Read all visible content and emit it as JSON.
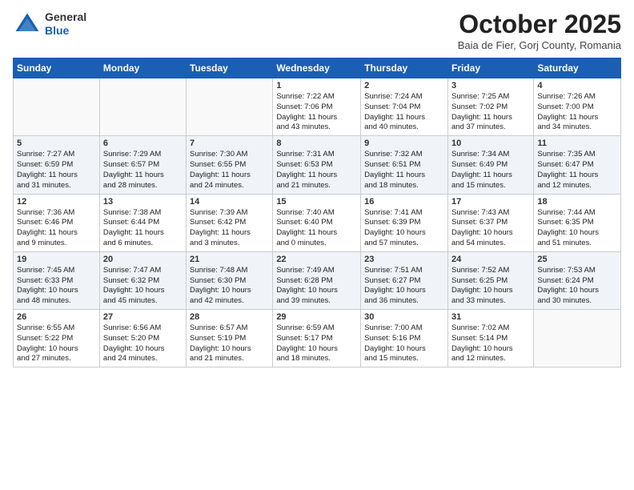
{
  "header": {
    "logo_general": "General",
    "logo_blue": "Blue",
    "month": "October 2025",
    "location": "Baia de Fier, Gorj County, Romania"
  },
  "weekdays": [
    "Sunday",
    "Monday",
    "Tuesday",
    "Wednesday",
    "Thursday",
    "Friday",
    "Saturday"
  ],
  "weeks": [
    [
      {
        "day": "",
        "info": ""
      },
      {
        "day": "",
        "info": ""
      },
      {
        "day": "",
        "info": ""
      },
      {
        "day": "1",
        "info": "Sunrise: 7:22 AM\nSunset: 7:06 PM\nDaylight: 11 hours\nand 43 minutes."
      },
      {
        "day": "2",
        "info": "Sunrise: 7:24 AM\nSunset: 7:04 PM\nDaylight: 11 hours\nand 40 minutes."
      },
      {
        "day": "3",
        "info": "Sunrise: 7:25 AM\nSunset: 7:02 PM\nDaylight: 11 hours\nand 37 minutes."
      },
      {
        "day": "4",
        "info": "Sunrise: 7:26 AM\nSunset: 7:00 PM\nDaylight: 11 hours\nand 34 minutes."
      }
    ],
    [
      {
        "day": "5",
        "info": "Sunrise: 7:27 AM\nSunset: 6:59 PM\nDaylight: 11 hours\nand 31 minutes."
      },
      {
        "day": "6",
        "info": "Sunrise: 7:29 AM\nSunset: 6:57 PM\nDaylight: 11 hours\nand 28 minutes."
      },
      {
        "day": "7",
        "info": "Sunrise: 7:30 AM\nSunset: 6:55 PM\nDaylight: 11 hours\nand 24 minutes."
      },
      {
        "day": "8",
        "info": "Sunrise: 7:31 AM\nSunset: 6:53 PM\nDaylight: 11 hours\nand 21 minutes."
      },
      {
        "day": "9",
        "info": "Sunrise: 7:32 AM\nSunset: 6:51 PM\nDaylight: 11 hours\nand 18 minutes."
      },
      {
        "day": "10",
        "info": "Sunrise: 7:34 AM\nSunset: 6:49 PM\nDaylight: 11 hours\nand 15 minutes."
      },
      {
        "day": "11",
        "info": "Sunrise: 7:35 AM\nSunset: 6:47 PM\nDaylight: 11 hours\nand 12 minutes."
      }
    ],
    [
      {
        "day": "12",
        "info": "Sunrise: 7:36 AM\nSunset: 6:46 PM\nDaylight: 11 hours\nand 9 minutes."
      },
      {
        "day": "13",
        "info": "Sunrise: 7:38 AM\nSunset: 6:44 PM\nDaylight: 11 hours\nand 6 minutes."
      },
      {
        "day": "14",
        "info": "Sunrise: 7:39 AM\nSunset: 6:42 PM\nDaylight: 11 hours\nand 3 minutes."
      },
      {
        "day": "15",
        "info": "Sunrise: 7:40 AM\nSunset: 6:40 PM\nDaylight: 11 hours\nand 0 minutes."
      },
      {
        "day": "16",
        "info": "Sunrise: 7:41 AM\nSunset: 6:39 PM\nDaylight: 10 hours\nand 57 minutes."
      },
      {
        "day": "17",
        "info": "Sunrise: 7:43 AM\nSunset: 6:37 PM\nDaylight: 10 hours\nand 54 minutes."
      },
      {
        "day": "18",
        "info": "Sunrise: 7:44 AM\nSunset: 6:35 PM\nDaylight: 10 hours\nand 51 minutes."
      }
    ],
    [
      {
        "day": "19",
        "info": "Sunrise: 7:45 AM\nSunset: 6:33 PM\nDaylight: 10 hours\nand 48 minutes."
      },
      {
        "day": "20",
        "info": "Sunrise: 7:47 AM\nSunset: 6:32 PM\nDaylight: 10 hours\nand 45 minutes."
      },
      {
        "day": "21",
        "info": "Sunrise: 7:48 AM\nSunset: 6:30 PM\nDaylight: 10 hours\nand 42 minutes."
      },
      {
        "day": "22",
        "info": "Sunrise: 7:49 AM\nSunset: 6:28 PM\nDaylight: 10 hours\nand 39 minutes."
      },
      {
        "day": "23",
        "info": "Sunrise: 7:51 AM\nSunset: 6:27 PM\nDaylight: 10 hours\nand 36 minutes."
      },
      {
        "day": "24",
        "info": "Sunrise: 7:52 AM\nSunset: 6:25 PM\nDaylight: 10 hours\nand 33 minutes."
      },
      {
        "day": "25",
        "info": "Sunrise: 7:53 AM\nSunset: 6:24 PM\nDaylight: 10 hours\nand 30 minutes."
      }
    ],
    [
      {
        "day": "26",
        "info": "Sunrise: 6:55 AM\nSunset: 5:22 PM\nDaylight: 10 hours\nand 27 minutes."
      },
      {
        "day": "27",
        "info": "Sunrise: 6:56 AM\nSunset: 5:20 PM\nDaylight: 10 hours\nand 24 minutes."
      },
      {
        "day": "28",
        "info": "Sunrise: 6:57 AM\nSunset: 5:19 PM\nDaylight: 10 hours\nand 21 minutes."
      },
      {
        "day": "29",
        "info": "Sunrise: 6:59 AM\nSunset: 5:17 PM\nDaylight: 10 hours\nand 18 minutes."
      },
      {
        "day": "30",
        "info": "Sunrise: 7:00 AM\nSunset: 5:16 PM\nDaylight: 10 hours\nand 15 minutes."
      },
      {
        "day": "31",
        "info": "Sunrise: 7:02 AM\nSunset: 5:14 PM\nDaylight: 10 hours\nand 12 minutes."
      },
      {
        "day": "",
        "info": ""
      }
    ]
  ]
}
